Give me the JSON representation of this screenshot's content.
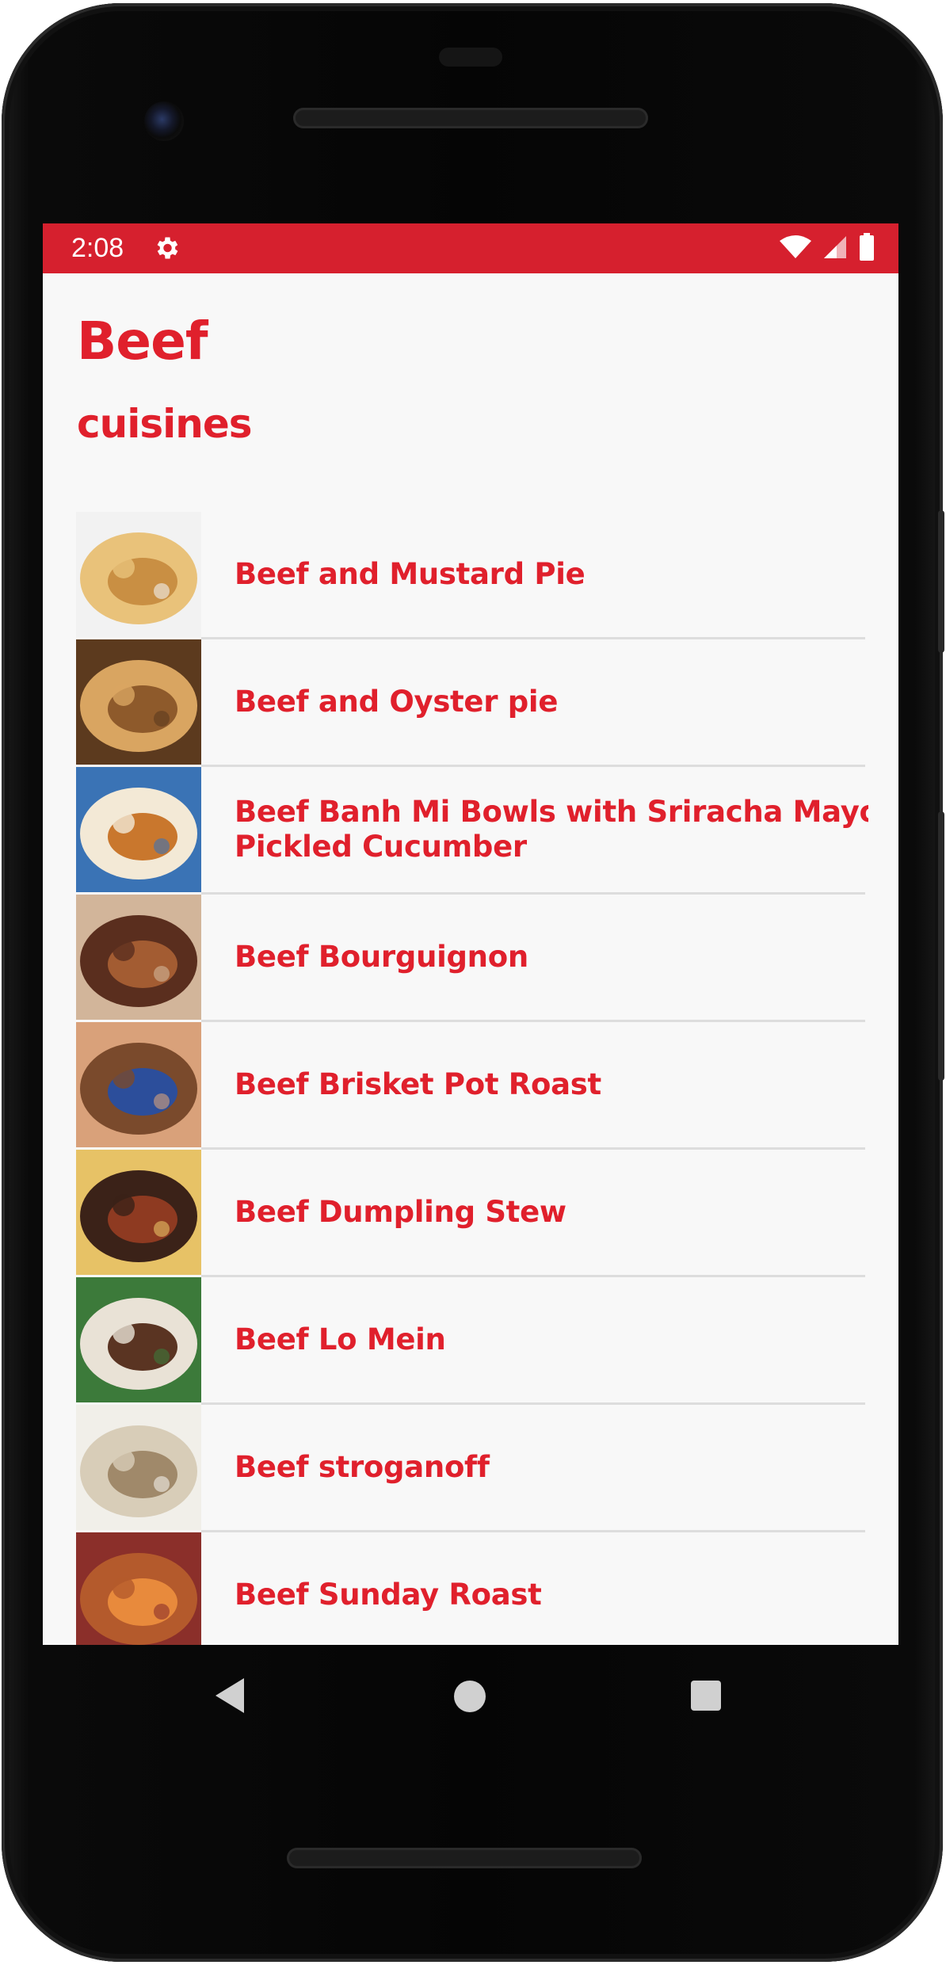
{
  "status_bar": {
    "time": "2:08",
    "settings_icon": "gear-icon",
    "wifi_icon": "wifi-icon",
    "signal_icon": "cell-signal-icon",
    "battery_icon": "battery-icon",
    "color": "#d6202e"
  },
  "header": {
    "title": "Beef",
    "subtitle": "cuisines",
    "accent_color": "#e0202c"
  },
  "meals": [
    {
      "name": "Beef and Mustard Pie",
      "thumb_colors": [
        "#e9c27a",
        "#c98f43",
        "#f2f2f2"
      ]
    },
    {
      "name": "Beef and Oyster pie",
      "thumb_colors": [
        "#d9a561",
        "#8e5a2b",
        "#5c3a1e"
      ]
    },
    {
      "name": "Beef Banh Mi Bowls with Sriracha Mayo, Carrot & \nPickled Cucumber",
      "thumb_colors": [
        "#f3e9d6",
        "#c9772d",
        "#3a73b5"
      ]
    },
    {
      "name": "Beef Bourguignon",
      "thumb_colors": [
        "#5a2e1e",
        "#a35c32",
        "#d2b59a"
      ]
    },
    {
      "name": "Beef Brisket Pot Roast",
      "thumb_colors": [
        "#7a4a2c",
        "#2c4e9b",
        "#d9a17a"
      ]
    },
    {
      "name": "Beef Dumpling Stew",
      "thumb_colors": [
        "#3b2218",
        "#8e3a21",
        "#e7c266"
      ]
    },
    {
      "name": "Beef Lo Mein",
      "thumb_colors": [
        "#e9e2d6",
        "#5a3422",
        "#3c7a3a"
      ]
    },
    {
      "name": "Beef stroganoff",
      "thumb_colors": [
        "#d8cdb8",
        "#a0896a",
        "#f1efe9"
      ]
    },
    {
      "name": "Beef Sunday Roast",
      "thumb_colors": [
        "#b45a2c",
        "#e88a3c",
        "#8b2f2a"
      ]
    }
  ],
  "nav_bar": {
    "back_icon": "back-triangle-icon",
    "home_icon": "home-circle-icon",
    "recents_icon": "recents-square-icon"
  }
}
